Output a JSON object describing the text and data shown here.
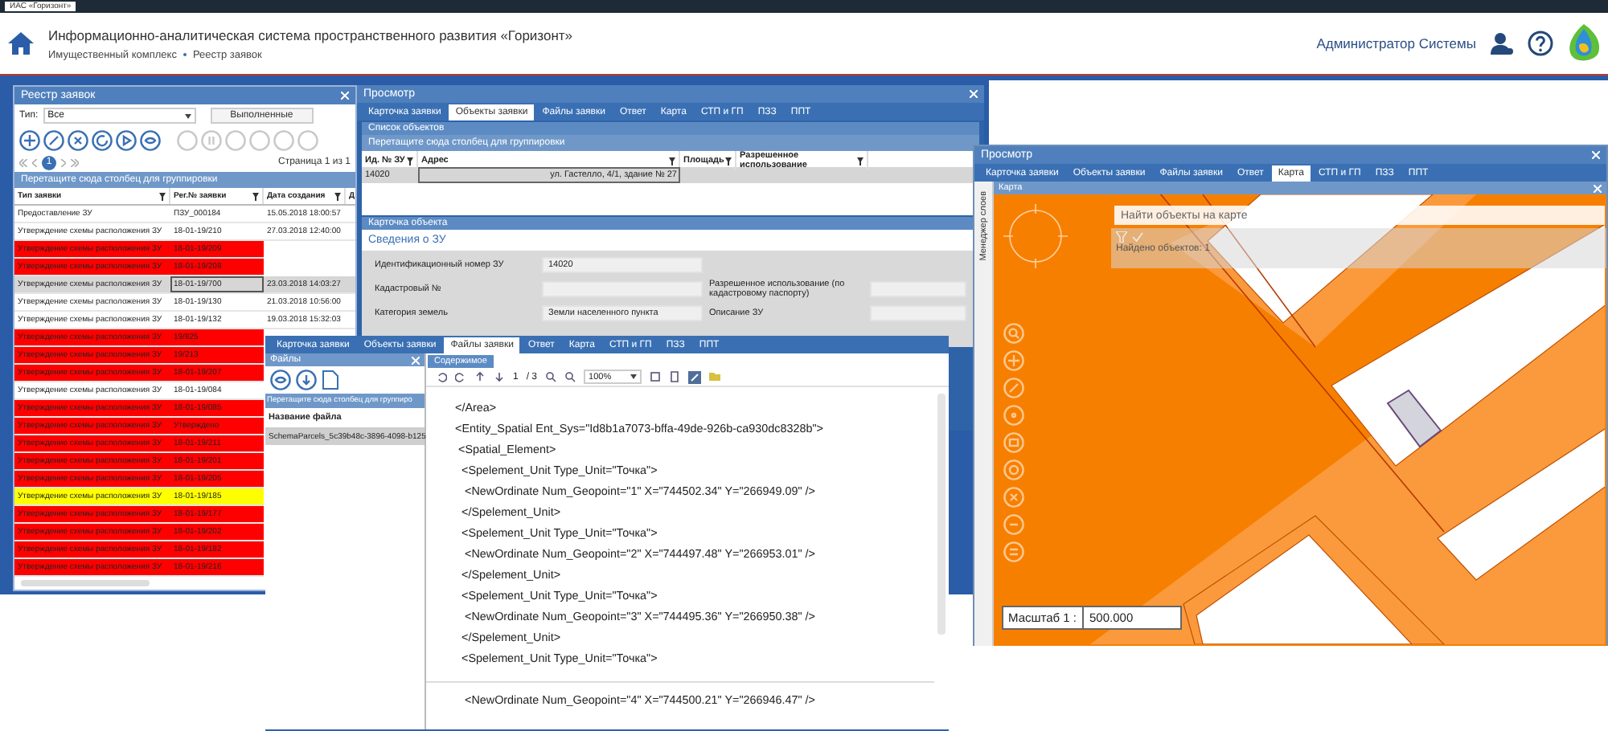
{
  "window": {
    "title": "ИАС «Горизонт»"
  },
  "header": {
    "title": "Информационно-аналитическая система пространственного развития «Горизонт»",
    "breadcrumb": [
      "Имущественный комплекс",
      "Реестр заявок"
    ],
    "user": "Администратор Системы"
  },
  "registry": {
    "title": "Реестр заявок",
    "type_label": "Тип:",
    "type_value": "Все",
    "done_button": "Выполненные",
    "pages": [
      {
        "label": "1",
        "selected": true
      }
    ],
    "page_info": "Страница 1 из 1",
    "group_hint": "Перетащите сюда столбец для группировки",
    "columns": [
      "Тип заявки",
      "Рег.№ заявки",
      "Дата создания",
      "Д"
    ],
    "rows": [
      {
        "type": "Предоставление ЗУ",
        "reg": "ПЗУ_000184",
        "date": "15.05.2018 18:00:57",
        "color": "#ffffff",
        "selected": false
      },
      {
        "type": "Утверждение схемы расположения ЗУ",
        "reg": "18-01-19/210",
        "date": "27.03.2018 12:40:00",
        "color": "#ffffff",
        "selected": false
      },
      {
        "type": "Утверждение схемы расположения ЗУ",
        "reg": "18-01-19/209",
        "color": "#ff0000",
        "selected": false
      },
      {
        "type": "Утверждение схемы расположения ЗУ",
        "reg": "18-01-19/208",
        "color": "#ff0000",
        "selected": false
      },
      {
        "type": "Утверждение схемы расположения ЗУ",
        "reg": "18-01-19/700",
        "date": "23.03.2018 14:03:27",
        "color": "#d6d6d6",
        "selected": true
      },
      {
        "type": "Утверждение схемы расположения ЗУ",
        "reg": "18-01-19/130",
        "date": "21.03.2018 10:56:00",
        "color": "#ffffff",
        "selected": false
      },
      {
        "type": "Утверждение схемы расположения ЗУ",
        "reg": "18-01-19/132",
        "date": "19.03.2018 15:32:03",
        "color": "#ffffff",
        "selected": false
      },
      {
        "type": "Утверждение схемы расположения ЗУ",
        "reg": "19/825",
        "color": "#ff0000",
        "selected": false
      },
      {
        "type": "Утверждение схемы расположения ЗУ",
        "reg": "19/213",
        "color": "#ff0000",
        "selected": false
      },
      {
        "type": "Утверждение схемы расположения ЗУ",
        "reg": "18-01-19/207",
        "color": "#ff0000",
        "selected": false
      },
      {
        "type": "Утверждение схемы расположения ЗУ",
        "reg": "18-01-19/084",
        "color": "#ffffff",
        "selected": false
      },
      {
        "type": "Утверждение схемы расположения ЗУ",
        "reg": "18-01-19/085",
        "color": "#ff0000",
        "selected": false
      },
      {
        "type": "Утверждение схемы расположения ЗУ",
        "reg": "Утверждено",
        "color": "#ff0000",
        "selected": false
      },
      {
        "type": "Утверждение схемы расположения ЗУ",
        "reg": "18-01-19/211",
        "color": "#ff0000",
        "selected": false
      },
      {
        "type": "Утверждение схемы расположения ЗУ",
        "reg": "18-01-19/201",
        "color": "#ff0000",
        "selected": false
      },
      {
        "type": "Утверждение схемы расположения ЗУ",
        "reg": "18-01-19/205",
        "color": "#ff0000",
        "selected": false
      },
      {
        "type": "Утверждение схемы расположения ЗУ",
        "reg": "18-01-19/185",
        "color": "#ffff00",
        "selected": false
      },
      {
        "type": "Утверждение схемы расположения ЗУ",
        "reg": "18-01-19/177",
        "color": "#ff0000",
        "selected": false
      },
      {
        "type": "Утверждение схемы расположения ЗУ",
        "reg": "18-01-19/202",
        "color": "#ff0000",
        "selected": false
      },
      {
        "type": "Утверждение схемы расположения ЗУ",
        "reg": "18-01-19/182",
        "color": "#ff0000",
        "selected": false
      },
      {
        "type": "Утверждение схемы расположения ЗУ",
        "reg": "18-01-19/216",
        "color": "#ff0000",
        "selected": false
      }
    ]
  },
  "view": {
    "title": "Просмотр",
    "tabs": [
      {
        "label": "Карточка заявки",
        "selected": false
      },
      {
        "label": "Объекты заявки",
        "selected": true
      },
      {
        "label": "Файлы заявки",
        "selected": false
      },
      {
        "label": "Ответ",
        "selected": false
      },
      {
        "label": "Карта",
        "selected": false
      },
      {
        "label": "СТП и ГП",
        "selected": false
      },
      {
        "label": "ПЗЗ",
        "selected": false
      },
      {
        "label": "ППТ",
        "selected": false
      }
    ],
    "objects_title": "Список объектов",
    "group_hint": "Перетащите сюда столбец для группировки",
    "columns": [
      "Ид. № ЗУ",
      "Адрес",
      "Площадь",
      "Разрешенное использование"
    ],
    "rows": [
      {
        "id": "14020",
        "address": "ул. Гастелло, 4/1, здание № 27",
        "selected": true
      }
    ],
    "card_title": "Карточка объекта",
    "section": "Сведения о ЗУ",
    "form": [
      [
        {
          "label": "Идентификационный номер ЗУ",
          "value": "14020"
        }
      ],
      [
        {
          "label": "Кадастровый №"
        },
        {
          "label": "Разрешенное использование (по кадастровому паспорту)"
        }
      ],
      [
        {
          "label": "Категория земель",
          "value": "Земли населенного пункта"
        },
        {
          "label": "Описание ЗУ"
        }
      ]
    ]
  },
  "files": {
    "tabs": [
      {
        "label": "Карточка заявки",
        "selected": false
      },
      {
        "label": "Объекты заявки",
        "selected": false
      },
      {
        "label": "Файлы заявки",
        "selected": true
      },
      {
        "label": "Ответ",
        "selected": false
      },
      {
        "label": "Карта",
        "selected": false
      },
      {
        "label": "СТП и ГП",
        "selected": false
      },
      {
        "label": "ПЗЗ",
        "selected": false
      },
      {
        "label": "ППТ",
        "selected": false
      }
    ],
    "pane_title": "Файлы",
    "group_hint": "Перетащите сюда столбец для группиро",
    "column": "Название файла",
    "items": [
      {
        "name": "SchemaParcels_5c39b48c-3896-4098-b125",
        "selected": true
      }
    ],
    "content_tab": "Содержимое",
    "page": "1",
    "page_total": "/ 3",
    "zoom": "100%",
    "pages": [
      [
        "</Area>",
        "<Entity_Spatial Ent_Sys=\"Id8b1a7073-bffa-49de-926b-ca930dc8328b\">",
        " <Spatial_Element>",
        "  <Spelement_Unit Type_Unit=\"Точка\">",
        "   <NewOrdinate Num_Geopoint=\"1\" X=\"744502.34\" Y=\"266949.09\" />",
        "  </Spelement_Unit>",
        "  <Spelement_Unit Type_Unit=\"Точка\">",
        "   <NewOrdinate Num_Geopoint=\"2\" X=\"744497.48\" Y=\"266953.01\" />",
        "  </Spelement_Unit>",
        "  <Spelement_Unit Type_Unit=\"Точка\">",
        "   <NewOrdinate Num_Geopoint=\"3\" X=\"744495.36\" Y=\"266950.38\" />",
        "  </Spelement_Unit>",
        "  <Spelement_Unit Type_Unit=\"Точка\">"
      ],
      [
        "   <NewOrdinate Num_Geopoint=\"4\" X=\"744500.21\" Y=\"266946.47\" />"
      ]
    ]
  },
  "map": {
    "title": "Просмотр",
    "tabs": [
      {
        "label": "Карточка заявки",
        "selected": false
      },
      {
        "label": "Объекты заявки",
        "selected": false
      },
      {
        "label": "Файлы заявки",
        "selected": false
      },
      {
        "label": "Ответ",
        "selected": false
      },
      {
        "label": "Карта",
        "selected": true
      },
      {
        "label": "СТП и ГП",
        "selected": false
      },
      {
        "label": "ПЗЗ",
        "selected": false
      },
      {
        "label": "ППТ",
        "selected": false
      }
    ],
    "panel_title": "Карта",
    "layers_tab": "Менеджер слоев",
    "search_placeholder": "Найти объекты на карте",
    "found": "Найдено объектов: 1",
    "scale_label": "Масштаб 1 :",
    "scale_value": "500.000"
  }
}
